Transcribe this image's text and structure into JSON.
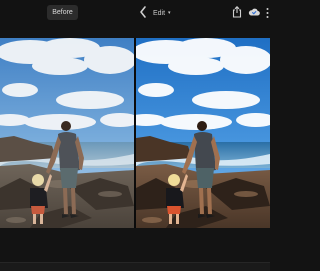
{
  "toolbar": {
    "before_label": "Before",
    "edit_label": "Edit",
    "edit_caret": "▾",
    "back_icon": "chevron-left-icon",
    "share_icon": "share-icon",
    "cloud_icon": "cloud-icon",
    "more_icon": "more-vertical-icon"
  },
  "comparison": {
    "left": "before-photo",
    "right": "after-photo"
  },
  "colors": {
    "accent": "#2f6fd6",
    "background": "#131313"
  }
}
